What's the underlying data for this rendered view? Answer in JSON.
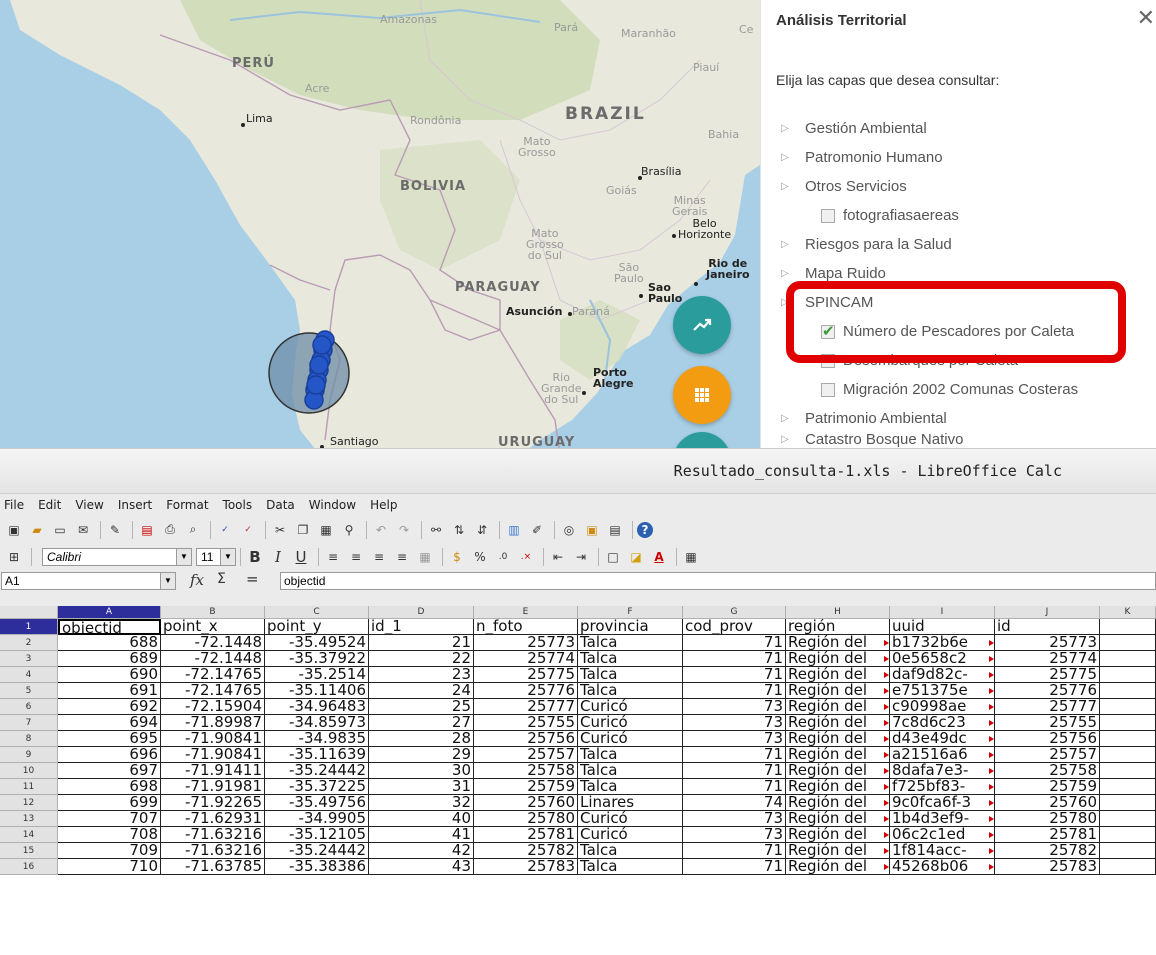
{
  "map": {
    "labels": {
      "peru": "PERÚ",
      "brazil": "BRAZIL",
      "bolivia": "BOLIVIA",
      "paraguay": "PARAGUAY",
      "uruguay": "URUGUAY",
      "amazonas": "Amazonas",
      "para": "Pará",
      "maranhao": "Maranhão",
      "ce": "Ce",
      "piaui": "Piauí",
      "acre": "Acre",
      "lima": "Lima",
      "rondonia": "Rondônia",
      "bahia": "Bahia",
      "mato_grosso": "Mato\nGrosso",
      "brasilia": "Brasília",
      "goias": "Goiás",
      "minas_gerais": "Minas\nGerais",
      "belo_horizonte": "Belo\nHorizonte",
      "mato_grosso_do_sul": "Mato\nGrosso\ndo Sul",
      "sao_paulo_state": "São\nPaulo",
      "rio_de_janeiro": "Rio de\nJaneiro",
      "sao_paulo_city": "Sao\nPaulo",
      "asuncion": "Asunción",
      "parana": "Paraná",
      "rio_grande_do_sul": "Rio\nGrande\ndo Sul",
      "porto_alegre": "Porto\nAlegre",
      "santiago": "Santiago"
    },
    "colors": {
      "water": "#a9cfe6",
      "land": "#e8e8dc",
      "land_green": "#cfdcb8",
      "fab_trend": "#2b9c9c",
      "fab_grid": "#f39c12",
      "marker": "#2456c8"
    },
    "fab_icons": [
      "trend-icon",
      "grid-icon",
      "more-icon"
    ]
  },
  "panel": {
    "title": "Análisis Territorial",
    "close": "✕",
    "subtitle": "Elija las capas que desea consultar:",
    "items": [
      {
        "label": "Gestión Ambiental",
        "type": "group"
      },
      {
        "label": "Patromonio Humano",
        "type": "group"
      },
      {
        "label": "Otros Servicios",
        "type": "group"
      },
      {
        "label": "fotografiasaereas",
        "type": "layer",
        "checked": false
      },
      {
        "label": "Riesgos para la Salud",
        "type": "group"
      },
      {
        "label": "Mapa Ruido",
        "type": "group"
      },
      {
        "label": "SPINCAM",
        "type": "group"
      },
      {
        "label": "Número de Pescadores por Caleta",
        "type": "layer",
        "checked": true
      },
      {
        "label": "Desembarques por Caleta",
        "type": "layer",
        "checked": false
      },
      {
        "label": "Migración 2002 Comunas Costeras",
        "type": "layer",
        "checked": false
      },
      {
        "label": "Patrimonio Ambiental",
        "type": "group"
      },
      {
        "label": "Catastro Bosque Nativo",
        "type": "group"
      }
    ]
  },
  "calc": {
    "title": "Resultado_consulta-1.xls - LibreOffice Calc",
    "menu": [
      "File",
      "Edit",
      "View",
      "Insert",
      "Format",
      "Tools",
      "Data",
      "Window",
      "Help"
    ],
    "font_name": "Calibri",
    "font_size": "11",
    "toolbar_text": {
      "bold": "B",
      "italic": "I",
      "underline": "U"
    },
    "name_box": "A1",
    "formula": "objectid",
    "formula_icons": {
      "fx": "fx",
      "sigma": "Σ",
      "equals": "="
    },
    "columns": [
      "A",
      "B",
      "C",
      "D",
      "E",
      "F",
      "G",
      "H",
      "I",
      "J",
      "K"
    ],
    "rows": [
      [
        "objectid",
        "point_x",
        "point_y",
        "id_1",
        "n_foto",
        "provincia",
        "cod_prov",
        "región",
        "uuid",
        "id"
      ],
      [
        "688",
        "-72.1448",
        "-35.49524",
        "21",
        "25773",
        "Talca",
        "71",
        "Región del",
        "b1732b6e",
        "25773"
      ],
      [
        "689",
        "-72.1448",
        "-35.37922",
        "22",
        "25774",
        "Talca",
        "71",
        "Región del",
        "0e5658c2",
        "25774"
      ],
      [
        "690",
        "-72.14765",
        "-35.2514",
        "23",
        "25775",
        "Talca",
        "71",
        "Región del",
        "daf9d82c-",
        "25775"
      ],
      [
        "691",
        "-72.14765",
        "-35.11406",
        "24",
        "25776",
        "Talca",
        "71",
        "Región del",
        "e751375e",
        "25776"
      ],
      [
        "692",
        "-72.15904",
        "-34.96483",
        "25",
        "25777",
        "Curicó",
        "73",
        "Región del",
        "c90998ae",
        "25777"
      ],
      [
        "694",
        "-71.89987",
        "-34.85973",
        "27",
        "25755",
        "Curicó",
        "73",
        "Región del",
        "7c8d6c23",
        "25755"
      ],
      [
        "695",
        "-71.90841",
        "-34.9835",
        "28",
        "25756",
        "Curicó",
        "73",
        "Región del",
        "d43e49dc",
        "25756"
      ],
      [
        "696",
        "-71.90841",
        "-35.11639",
        "29",
        "25757",
        "Talca",
        "71",
        "Región del",
        "a21516a6",
        "25757"
      ],
      [
        "697",
        "-71.91411",
        "-35.24442",
        "30",
        "25758",
        "Talca",
        "71",
        "Región del",
        "8dafa7e3-",
        "25758"
      ],
      [
        "698",
        "-71.91981",
        "-35.37225",
        "31",
        "25759",
        "Talca",
        "71",
        "Región del",
        "f725bf83-",
        "25759"
      ],
      [
        "699",
        "-71.92265",
        "-35.49756",
        "32",
        "25760",
        "Linares",
        "74",
        "Región del",
        "9c0fca6f-3",
        "25760"
      ],
      [
        "707",
        "-71.62931",
        "-34.9905",
        "40",
        "25780",
        "Curicó",
        "73",
        "Región del",
        "1b4d3ef9-",
        "25780"
      ],
      [
        "708",
        "-71.63216",
        "-35.12105",
        "41",
        "25781",
        "Curicó",
        "73",
        "Región del",
        "06c2c1ed",
        "25781"
      ],
      [
        "709",
        "-71.63216",
        "-35.24442",
        "42",
        "25782",
        "Talca",
        "71",
        "Región del",
        "1f814acc-",
        "25782"
      ],
      [
        "710",
        "-71.63785",
        "-35.38386",
        "43",
        "25783",
        "Talca",
        "71",
        "Región del",
        "45268b06",
        "25783"
      ]
    ]
  }
}
